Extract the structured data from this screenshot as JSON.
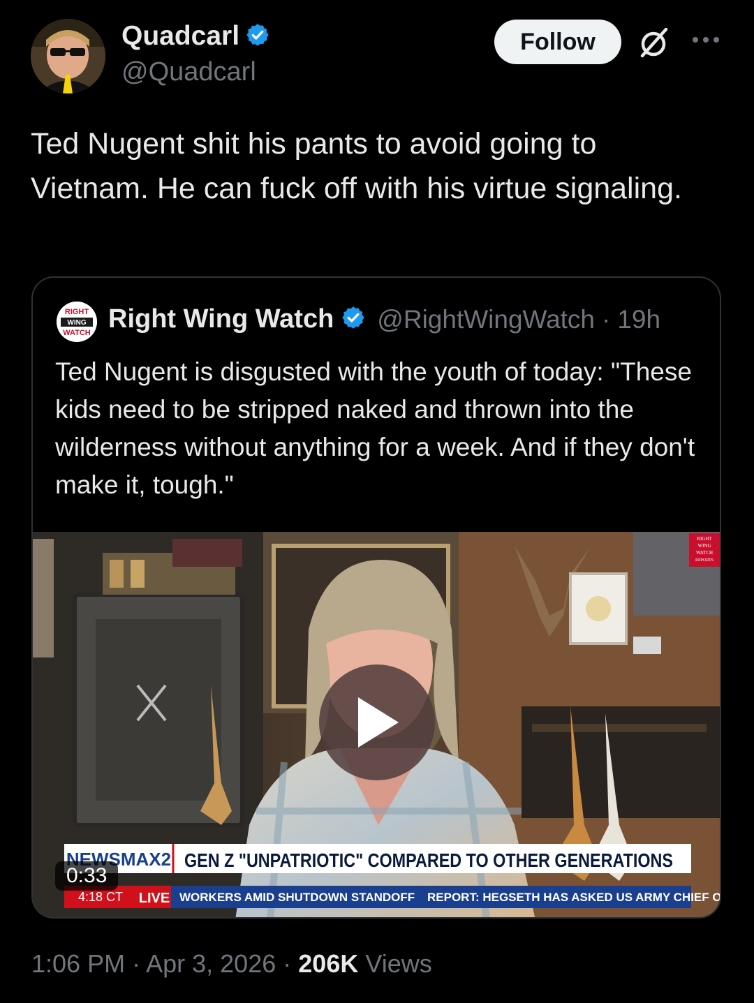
{
  "author": {
    "display_name": "Quadcarl",
    "handle": "@Quadcarl",
    "verified": true
  },
  "actions": {
    "follow_label": "Follow",
    "grok_icon": "grok-icon",
    "more_icon": "more-icon"
  },
  "tweet": {
    "text": "Ted Nugent shit his pants to avoid going to Vietnam. He can fuck off with his virtue signaling."
  },
  "quote": {
    "logo_text": [
      "RIGHT",
      "WING",
      "WATCH"
    ],
    "display_name": "Right Wing Watch",
    "handle": "@RightWingWatch",
    "separator": "·",
    "time": "19h",
    "verified": true,
    "text": "Ted Nugent is disgusted with the youth of today: \"These kids need to be stripped naked and thrown into the wilderness without anything for a week. And if they don't make it, tough.\"",
    "video": {
      "duration": "0:33",
      "watermark": [
        "RIGHT",
        "WING",
        "WATCH",
        "REPORTS"
      ],
      "channel": "NEWSMAX2",
      "clock": "4:18 CT",
      "live_label": "LIVE",
      "headline": "GEN Z \"UNPATRIOTIC\" COMPARED TO OTHER GENERATIONS",
      "ticker_1": "WORKERS AMID SHUTDOWN STANDOFF",
      "ticker_2": "REPORT: HEGSETH HAS ASKED US ARMY CHIEF O"
    }
  },
  "meta": {
    "time": "1:06 PM",
    "separator": "·",
    "date": "Apr 3, 2026",
    "views_count": "206K",
    "views_label": "Views"
  },
  "colors": {
    "background": "#000000",
    "text": "#e7e9ea",
    "muted": "#71767b",
    "verified": "#1d9bf0",
    "border": "#2f3336",
    "newsmax_blue": "#1b3f8f",
    "live_red": "#d0101a"
  }
}
